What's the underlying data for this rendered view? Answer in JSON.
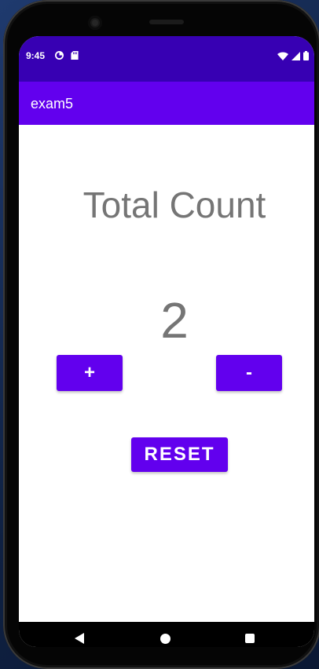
{
  "status_bar": {
    "time": "9:45",
    "left_icons": [
      "data-saver-icon",
      "sd-card-icon"
    ],
    "right_icons": [
      "wifi-icon",
      "cell-signal-icon",
      "battery-icon"
    ],
    "background": "#3700b3"
  },
  "app_bar": {
    "title": "exam5",
    "background": "#6200ee"
  },
  "main": {
    "title": "Total Count",
    "count": "2",
    "text_color": "#757575"
  },
  "buttons": {
    "increment_label": "+",
    "decrement_label": "-",
    "reset_label": "RESET",
    "color": "#6200ee"
  },
  "nav_bar": {
    "icons": [
      "back-icon",
      "home-icon",
      "recent-apps-icon"
    ]
  }
}
